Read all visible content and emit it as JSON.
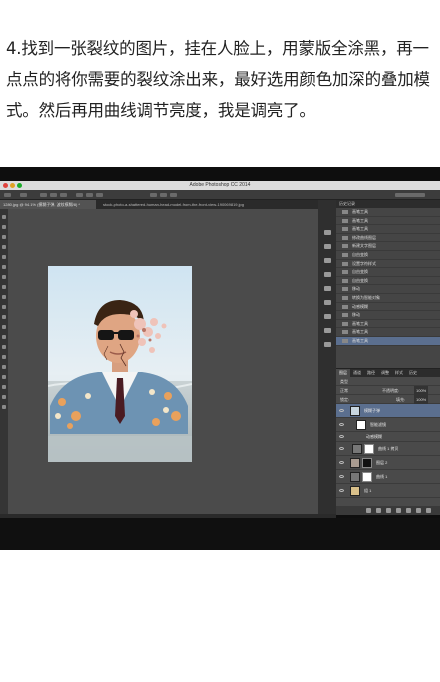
{
  "article": {
    "paragraph": "4.找到一张裂纹的图片，挂在人脸上，用蒙版全涂黑，再一点点的将你需要的裂纹涂出来，最好选用颜色加深的叠加模式。然后再用曲线调节亮度，我是调亮了。"
  },
  "photoshop": {
    "window_title": "Adobe Photoshop CC 2014",
    "tabs": [
      "1280.jpg @ 94.1% (模糊子弹, 波纹模糊/8) *",
      "stock-photo-a-shattered-human-head-model-from-the-front-view-190069819.jpg"
    ],
    "history": {
      "header": "历史记录",
      "items": [
        "画笔工具",
        "画笔工具",
        "画笔工具",
        "修改曲线图层",
        "新建文字图层",
        "自由变换",
        "设置字符样式",
        "自由变换",
        "自由变换",
        "移动",
        "转换为智能对象",
        "动感模糊",
        "移动",
        "画笔工具",
        "画笔工具",
        "画笔工具"
      ],
      "selected_index": 15
    },
    "layers": {
      "tabs": [
        "图层",
        "通道",
        "路径",
        "调整",
        "样式",
        "历史"
      ],
      "kind_label": "类型",
      "blend_mode": "正常",
      "opacity_label": "不透明度:",
      "opacity": "100%",
      "lock_label": "锁定:",
      "fill_label": "填充:",
      "fill": "100%",
      "rows": [
        {
          "name": "模糊子弹",
          "type": "smart"
        },
        {
          "name": "智能滤镜",
          "type": "filter"
        },
        {
          "name": "动感模糊",
          "type": "effect"
        },
        {
          "name": "曲线 1 拷贝",
          "type": "adjust"
        },
        {
          "name": "图层 2",
          "type": "masked"
        },
        {
          "name": "曲线 1",
          "type": "adjust"
        },
        {
          "name": "组 1",
          "type": "group"
        }
      ],
      "selected_index": 0
    }
  },
  "colors": {
    "selection": "#5b6f8f",
    "panel_bg": "#4a4a4a",
    "canvas_bg": "#4b4b4b"
  }
}
